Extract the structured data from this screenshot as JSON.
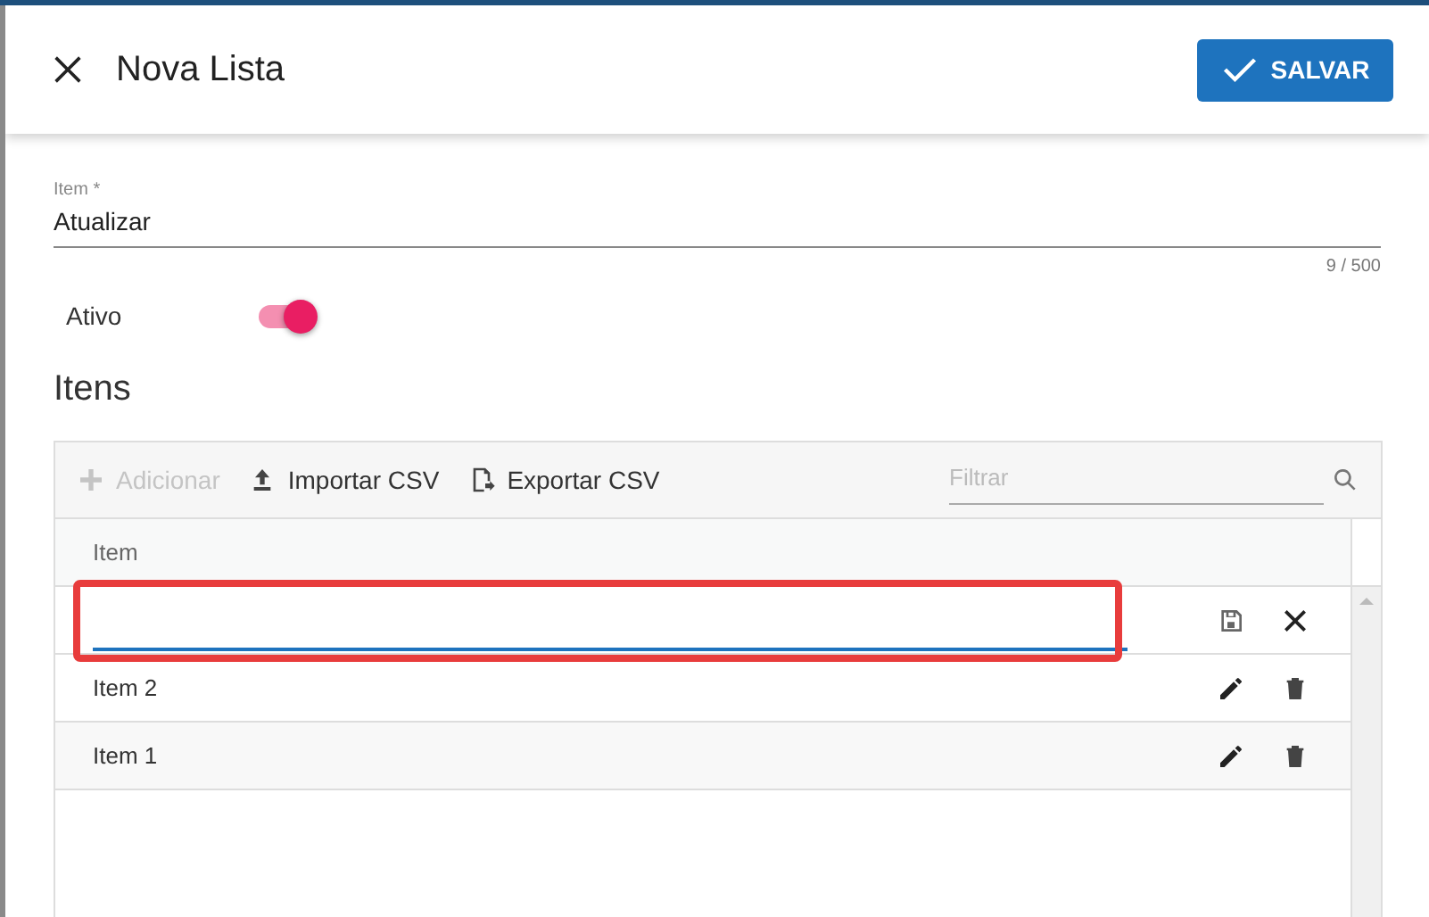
{
  "dialog": {
    "title": "Nova Lista",
    "save_button": "SALVAR"
  },
  "form": {
    "item_field": {
      "label": "Item *",
      "value": "Atualizar",
      "counter": "9 / 500"
    },
    "active": {
      "label": "Ativo",
      "on": true
    }
  },
  "section_title": "Itens",
  "toolbar": {
    "buttons": [
      {
        "label": "Adicionar",
        "kind": "add",
        "disabled": true
      },
      {
        "label": "Importar CSV",
        "kind": "import",
        "disabled": false
      },
      {
        "label": "Exportar CSV",
        "kind": "export",
        "disabled": false
      }
    ],
    "filter": {
      "placeholder": "Filtrar"
    }
  },
  "table": {
    "columns": [
      "Item"
    ],
    "rows": [
      {
        "kind": "edit",
        "value": "",
        "highlighted": true
      },
      {
        "kind": "item",
        "value": "Item 2",
        "highlighted": false
      },
      {
        "kind": "item",
        "value": "Item 1",
        "highlighted": false
      }
    ]
  }
}
